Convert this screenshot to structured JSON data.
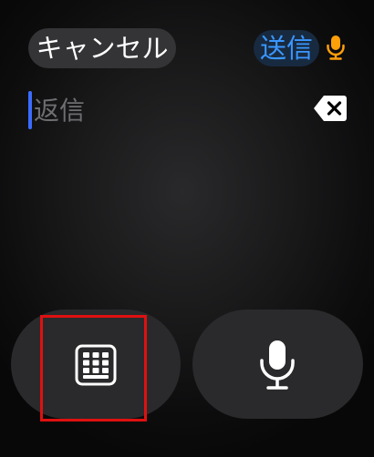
{
  "header": {
    "cancel_label": "キャンセル",
    "send_label": "送信",
    "mic_icon": "mic-icon",
    "send_color": "#3a97ff",
    "mic_color": "#ff9f0a"
  },
  "input": {
    "placeholder": "返信",
    "delete_icon": "delete-left-icon"
  },
  "bottom": {
    "keypad_icon": "keypad-grid-icon",
    "dictation_icon": "microphone-icon"
  }
}
